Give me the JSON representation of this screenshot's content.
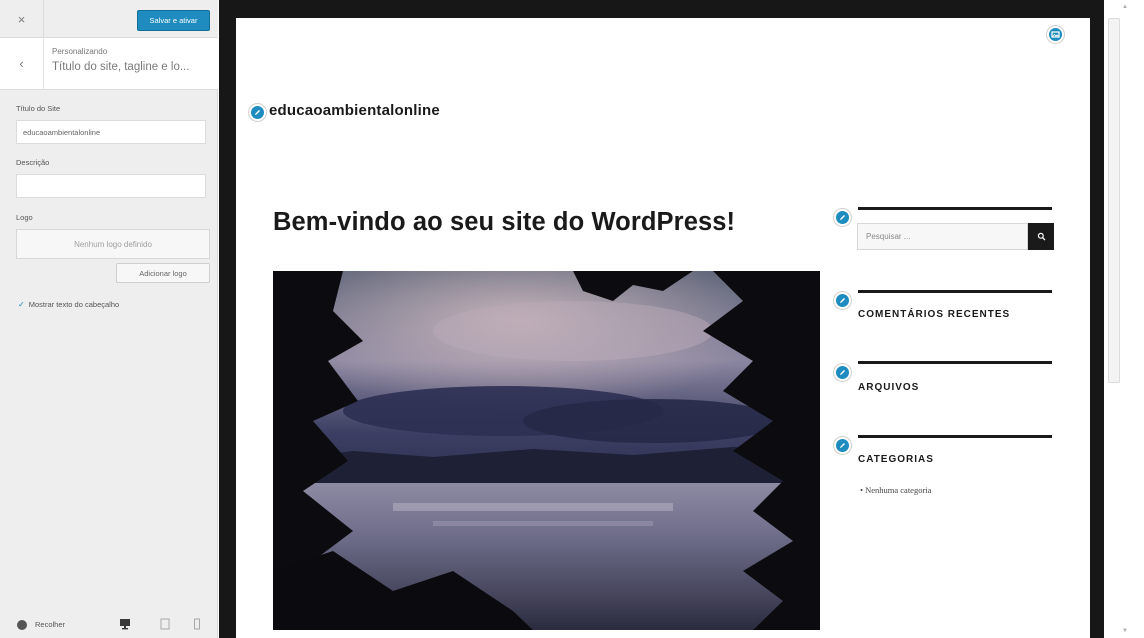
{
  "sidebar": {
    "close_glyph": "×",
    "save_label": "Salvar e ativar",
    "back_glyph": "‹",
    "breadcrumb": "Personalizando",
    "section_title": "Título do site, tagline e lo...",
    "site_title_label": "Título do Site",
    "site_title_value": "educaoambientalonline",
    "description_label": "Descrição",
    "description_value": "",
    "logo_label": "Logo",
    "no_logo_text": "Nenhum logo definido",
    "add_logo_label": "Adicionar logo",
    "show_header_text_label": "Mostrar texto do cabeçalho",
    "show_header_text_checked": true,
    "collapse_label": "Recolher"
  },
  "preview": {
    "site_title": "educaoambientalonline",
    "post_title": "Bem-vindo ao seu site do WordPress!",
    "search_placeholder": "Pesquisar ...",
    "widgets": {
      "recent_comments": "COMENTÁRIOS RECENTES",
      "archives": "ARQUIVOS",
      "categories": "CATEGORIAS"
    },
    "category_item": "Nenhuma categoria"
  },
  "colors": {
    "accent": "#1e8cbe",
    "frame": "#171717",
    "sidebar_bg": "#eeeeee"
  },
  "icons": {
    "close": "close-icon",
    "back": "chevron-left-icon",
    "edit_shortcut": "pencil-icon",
    "header_image_shortcut": "image-icon",
    "search": "search-icon",
    "collapse": "collapse-icon",
    "desktop": "desktop-icon",
    "tablet": "tablet-icon",
    "mobile": "mobile-icon"
  }
}
